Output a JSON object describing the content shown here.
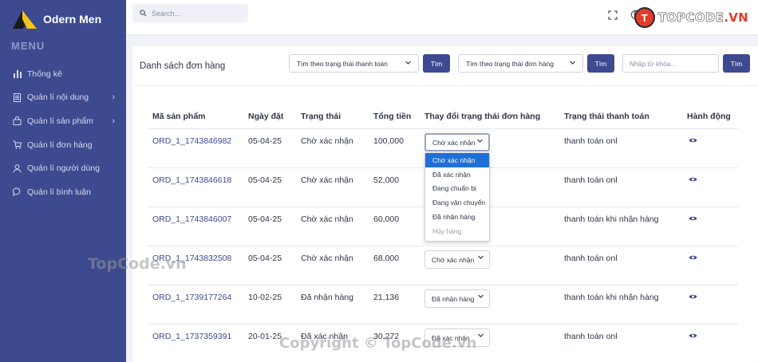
{
  "brand": {
    "name": "Odern Men"
  },
  "sidebar": {
    "menu_title": "MENU",
    "items": [
      {
        "label": "Thống kê",
        "icon": "bar-chart-icon",
        "has_submenu": false
      },
      {
        "label": "Quản lí nội dung",
        "icon": "document-icon",
        "has_submenu": true
      },
      {
        "label": "Quản lí sản phẩm",
        "icon": "bag-icon",
        "has_submenu": true
      },
      {
        "label": "Quản lí đơn hàng",
        "icon": "cart-icon",
        "has_submenu": false
      },
      {
        "label": "Quản lí người dùng",
        "icon": "user-icon",
        "has_submenu": false
      },
      {
        "label": "Quản lí bình luận",
        "icon": "comment-icon",
        "has_submenu": false
      }
    ]
  },
  "topbar": {
    "search_placeholder": "Search...",
    "watermark_letter": "T",
    "watermark_text_main": "TOPCODE",
    "watermark_text_tail": ".VN"
  },
  "page": {
    "title": "Danh sách đơn hàng",
    "filter_payment": "Tìm theo trạng thái thanh toán",
    "filter_order": "Tìm theo trạng thái đơn hàng",
    "search_btn": "Tìm",
    "keyword_placeholder": "Nhập từ khóa..."
  },
  "table": {
    "headers": [
      "Mã sản phẩm",
      "Ngày đặt",
      "Trạng thái",
      "Tổng tiền",
      "Thay đổi trạng thái đơn hàng",
      "Trạng thái thanh toán",
      "Hành động"
    ],
    "rows": [
      {
        "id": "ORD_1_1743846982",
        "date": "05-04-25",
        "status": "Chờ xác nhận",
        "total": "100,000",
        "select": "Chờ xác nhận",
        "payment": "thanh toán onl"
      },
      {
        "id": "ORD_1_1743846618",
        "date": "05-04-25",
        "status": "Chờ xác nhận",
        "total": "52,000",
        "select": "",
        "payment": "thanh toán onl"
      },
      {
        "id": "ORD_1_1743846007",
        "date": "05-04-25",
        "status": "Chờ xác nhận",
        "total": "60,000",
        "select": "",
        "payment": "thanh toán khi nhận hàng"
      },
      {
        "id": "ORD_1_1743832508",
        "date": "05-04-25",
        "status": "Chờ xác nhận",
        "total": "68,000",
        "select": "Chờ xác nhận",
        "payment": "thanh toán onl"
      },
      {
        "id": "ORD_1_1739177264",
        "date": "10-02-25",
        "status": "Đã nhận hàng",
        "total": "21,136",
        "select": "Đã nhận hàng",
        "payment": "thanh toán khi nhận hàng"
      },
      {
        "id": "ORD_1_1737359391",
        "date": "20-01-25",
        "status": "Đã xác nhận",
        "total": "30,272",
        "select": "Đã xác nhận",
        "payment": "thanh toán onl"
      }
    ]
  },
  "dropdown": {
    "options": [
      "Chờ xác nhận",
      "Đã xác nhận",
      "Đang chuẩn bị",
      "Đang vận chuyển",
      "Đã nhận hàng",
      "Hủy hàng"
    ],
    "selected": "Chờ xác nhận",
    "disabled": "Hủy hàng"
  },
  "watermarks": {
    "mid": "TopCode.vn",
    "bottom": "Copyright © TopCode.vn"
  },
  "colors": {
    "sidebar": "#3d4a8f",
    "accent": "#3d4a8f",
    "selected_option": "#1f6fd6",
    "watermark_red": "#e23d2a"
  }
}
